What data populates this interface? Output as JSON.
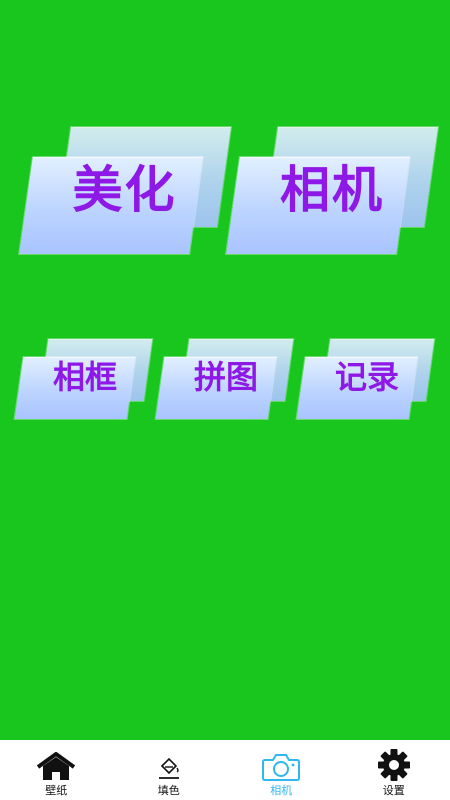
{
  "tiles": {
    "beautify": "美化",
    "camera": "相机",
    "frame": "相框",
    "collage": "拼图",
    "record": "记录"
  },
  "nav": {
    "items": [
      {
        "label": "壁纸",
        "icon": "home-icon"
      },
      {
        "label": "填色",
        "icon": "paint-bucket-icon"
      },
      {
        "label": "相机",
        "icon": "camera-icon",
        "active": true
      },
      {
        "label": "设置",
        "icon": "gear-icon"
      }
    ]
  },
  "colors": {
    "background": "#18c61e",
    "tile_text": "#8e18e6",
    "active_nav": "#2fb8f0"
  }
}
